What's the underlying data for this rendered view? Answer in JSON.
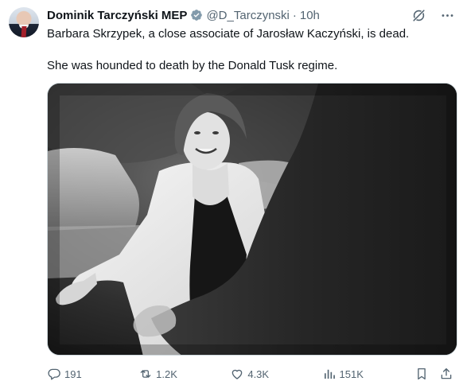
{
  "tweet": {
    "author_name": "Dominik Tarczyński MEP",
    "handle": "@D_Tarczynski",
    "separator": "·",
    "time": "10h",
    "paragraph1": "Barbara Skrzypek, a close associate of Jarosław Kaczyński, is dead.",
    "paragraph2": "She was hounded to death by the Donald Tusk regime."
  },
  "actions": {
    "replies": "191",
    "reposts": "1.2K",
    "likes": "4.3K",
    "views": "151K"
  },
  "colors": {
    "text": "#0f1419",
    "secondary": "#536471",
    "verified_badge": "#829aab",
    "border": "#cfd9de"
  },
  "icons": {
    "verified": "verified-badge-icon",
    "grok": "grok-icon",
    "more": "more-icon",
    "reply": "reply-icon",
    "repost": "repost-icon",
    "like": "like-icon",
    "views": "views-icon",
    "bookmark": "bookmark-icon",
    "share": "share-icon"
  }
}
